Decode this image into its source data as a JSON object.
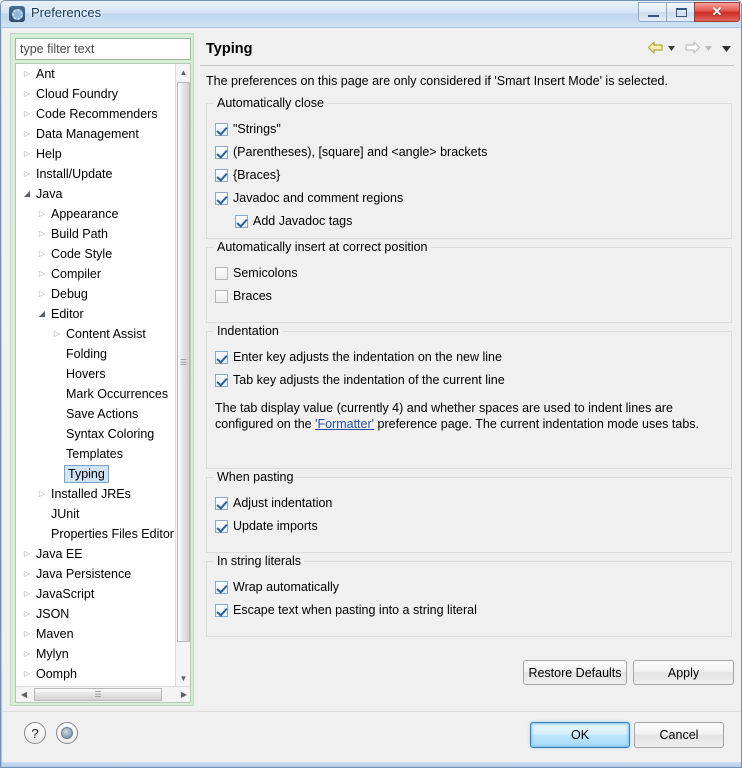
{
  "window": {
    "title": "Preferences",
    "icon": "preferences-gear-icon",
    "buttons": {
      "minimize": "minimize",
      "maximize": "maximize",
      "close": "✕"
    }
  },
  "filter": {
    "placeholder": "type filter text",
    "value": ""
  },
  "tree": {
    "items": [
      {
        "label": "Ant",
        "indent": 0,
        "twisty": "collapsed",
        "selected": false
      },
      {
        "label": "Cloud Foundry",
        "indent": 0,
        "twisty": "collapsed",
        "selected": false
      },
      {
        "label": "Code Recommenders",
        "indent": 0,
        "twisty": "collapsed",
        "selected": false
      },
      {
        "label": "Data Management",
        "indent": 0,
        "twisty": "collapsed",
        "selected": false
      },
      {
        "label": "Help",
        "indent": 0,
        "twisty": "collapsed",
        "selected": false
      },
      {
        "label": "Install/Update",
        "indent": 0,
        "twisty": "collapsed",
        "selected": false
      },
      {
        "label": "Java",
        "indent": 0,
        "twisty": "expanded",
        "selected": false
      },
      {
        "label": "Appearance",
        "indent": 1,
        "twisty": "collapsed",
        "selected": false
      },
      {
        "label": "Build Path",
        "indent": 1,
        "twisty": "collapsed",
        "selected": false
      },
      {
        "label": "Code Style",
        "indent": 1,
        "twisty": "collapsed",
        "selected": false
      },
      {
        "label": "Compiler",
        "indent": 1,
        "twisty": "collapsed",
        "selected": false
      },
      {
        "label": "Debug",
        "indent": 1,
        "twisty": "collapsed",
        "selected": false
      },
      {
        "label": "Editor",
        "indent": 1,
        "twisty": "expanded",
        "selected": false
      },
      {
        "label": "Content Assist",
        "indent": 2,
        "twisty": "collapsed",
        "selected": false
      },
      {
        "label": "Folding",
        "indent": 2,
        "twisty": "none",
        "selected": false
      },
      {
        "label": "Hovers",
        "indent": 2,
        "twisty": "none",
        "selected": false
      },
      {
        "label": "Mark Occurrences",
        "indent": 2,
        "twisty": "none",
        "selected": false
      },
      {
        "label": "Save Actions",
        "indent": 2,
        "twisty": "none",
        "selected": false
      },
      {
        "label": "Syntax Coloring",
        "indent": 2,
        "twisty": "none",
        "selected": false
      },
      {
        "label": "Templates",
        "indent": 2,
        "twisty": "none",
        "selected": false
      },
      {
        "label": "Typing",
        "indent": 2,
        "twisty": "none",
        "selected": true
      },
      {
        "label": "Installed JREs",
        "indent": 1,
        "twisty": "collapsed",
        "selected": false
      },
      {
        "label": "JUnit",
        "indent": 1,
        "twisty": "none",
        "selected": false
      },
      {
        "label": "Properties Files Editor",
        "indent": 1,
        "twisty": "none",
        "selected": false
      },
      {
        "label": "Java EE",
        "indent": 0,
        "twisty": "collapsed",
        "selected": false
      },
      {
        "label": "Java Persistence",
        "indent": 0,
        "twisty": "collapsed",
        "selected": false
      },
      {
        "label": "JavaScript",
        "indent": 0,
        "twisty": "collapsed",
        "selected": false
      },
      {
        "label": "JSON",
        "indent": 0,
        "twisty": "collapsed",
        "selected": false
      },
      {
        "label": "Maven",
        "indent": 0,
        "twisty": "collapsed",
        "selected": false
      },
      {
        "label": "Mylyn",
        "indent": 0,
        "twisty": "collapsed",
        "selected": false
      },
      {
        "label": "Oomph",
        "indent": 0,
        "twisty": "collapsed",
        "selected": false
      }
    ]
  },
  "page": {
    "title": "Typing",
    "intro": "The preferences on this page are only considered if 'Smart Insert Mode' is selected.",
    "nav": {
      "back": "back-arrow",
      "back_menu": "chevron-down",
      "forward": "forward-arrow",
      "forward_menu": "chevron-down",
      "view_menu": "chevron-down"
    },
    "groups": [
      {
        "title": "Automatically close",
        "options": [
          {
            "label": "\"Strings\"",
            "checked": true,
            "indent": 0
          },
          {
            "label": "(Parentheses), [square] and <angle> brackets",
            "checked": true,
            "indent": 0
          },
          {
            "label": "{Braces}",
            "checked": true,
            "indent": 0
          },
          {
            "label": "Javadoc and comment regions",
            "checked": true,
            "indent": 0
          },
          {
            "label": "Add Javadoc tags",
            "checked": true,
            "indent": 1
          }
        ]
      },
      {
        "title": "Automatically insert at correct position",
        "options": [
          {
            "label": "Semicolons",
            "checked": false,
            "indent": 0
          },
          {
            "label": "Braces",
            "checked": false,
            "indent": 0
          }
        ]
      },
      {
        "title": "Indentation",
        "options": [
          {
            "label": "Enter key adjusts the indentation on the new line",
            "checked": true,
            "indent": 0
          },
          {
            "label": "Tab key adjusts the indentation of the current line",
            "checked": true,
            "indent": 0
          }
        ],
        "description": {
          "before": "The tab display value (currently 4) and whether spaces are used to indent lines are configured on the ",
          "link": "'Formatter'",
          "after": " preference page. The current indentation mode uses tabs."
        }
      },
      {
        "title": "When pasting",
        "options": [
          {
            "label": "Adjust indentation",
            "checked": true,
            "indent": 0
          },
          {
            "label": "Update imports",
            "checked": true,
            "indent": 0
          }
        ]
      },
      {
        "title": "In string literals",
        "options": [
          {
            "label": "Wrap automatically",
            "checked": true,
            "indent": 0
          },
          {
            "label": "Escape text when pasting into a string literal",
            "checked": true,
            "indent": 0
          }
        ]
      }
    ],
    "restore_defaults_label": "Restore Defaults",
    "apply_label": "Apply"
  },
  "footer": {
    "help_icon": "?",
    "web_icon": "globe-icon",
    "ok_label": "OK",
    "cancel_label": "Cancel"
  }
}
